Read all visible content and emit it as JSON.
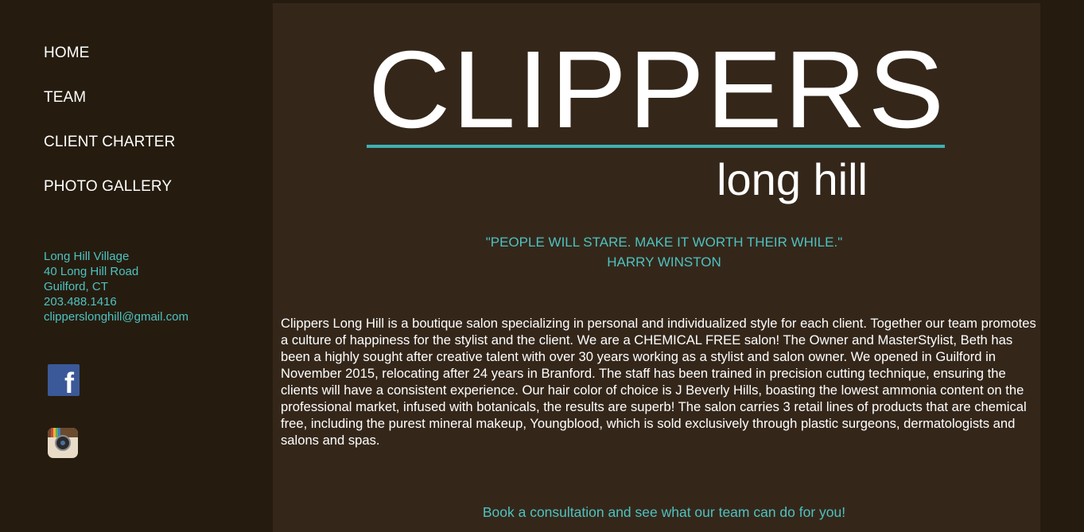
{
  "nav": {
    "items": [
      {
        "label": "HOME"
      },
      {
        "label": "TEAM"
      },
      {
        "label": "CLIENT CHARTER"
      },
      {
        "label": "PHOTO GALLERY"
      }
    ]
  },
  "address": {
    "line1": "Long Hill Village",
    "line2": "40 Long Hill Road",
    "line3": "Guilford, CT",
    "phone": "203.488.1416",
    "email": "clipperslonghill@gmail.com"
  },
  "social": {
    "facebook_icon": "facebook-icon",
    "instagram_icon": "instagram-icon"
  },
  "logo": {
    "wordmark": "CLIPPERS",
    "subtitle": "long hill"
  },
  "quote": {
    "text": "\"PEOPLE WILL STARE. MAKE IT WORTH THEIR WHILE.\"",
    "author": "HARRY WINSTON"
  },
  "about": {
    "text": "Clippers Long Hill is a boutique salon specializing in personal and individualized style for each client. Together our team promotes a culture of happiness for the stylist and the client. We are a CHEMICAL FREE salon! The Owner and MasterStylist, Beth has been a highly sought after creative talent with over 30 years working as a stylist and salon owner. We opened in Guilford in November 2015, relocating after 24 years in Branford. The staff has been trained in precision cutting technique, ensuring the clients will have a consistent experience. Our hair color of choice is J Beverly Hills, boasting the lowest ammonia content on the professional market, infused with botanicals, the results are superb! The salon carries 3 retail lines of products that are chemical free, including the purest mineral makeup, Youngblood, which is sold exclusively through plastic surgeons, dermatologists and salons and spas."
  },
  "cta": {
    "text": "Book a consultation and see what our team can do for you!"
  },
  "colors": {
    "sidebar_bg": "#251c0f",
    "main_bg": "#34271a",
    "accent": "#4ec2c0",
    "logo_rule": "#3fb0b3"
  }
}
